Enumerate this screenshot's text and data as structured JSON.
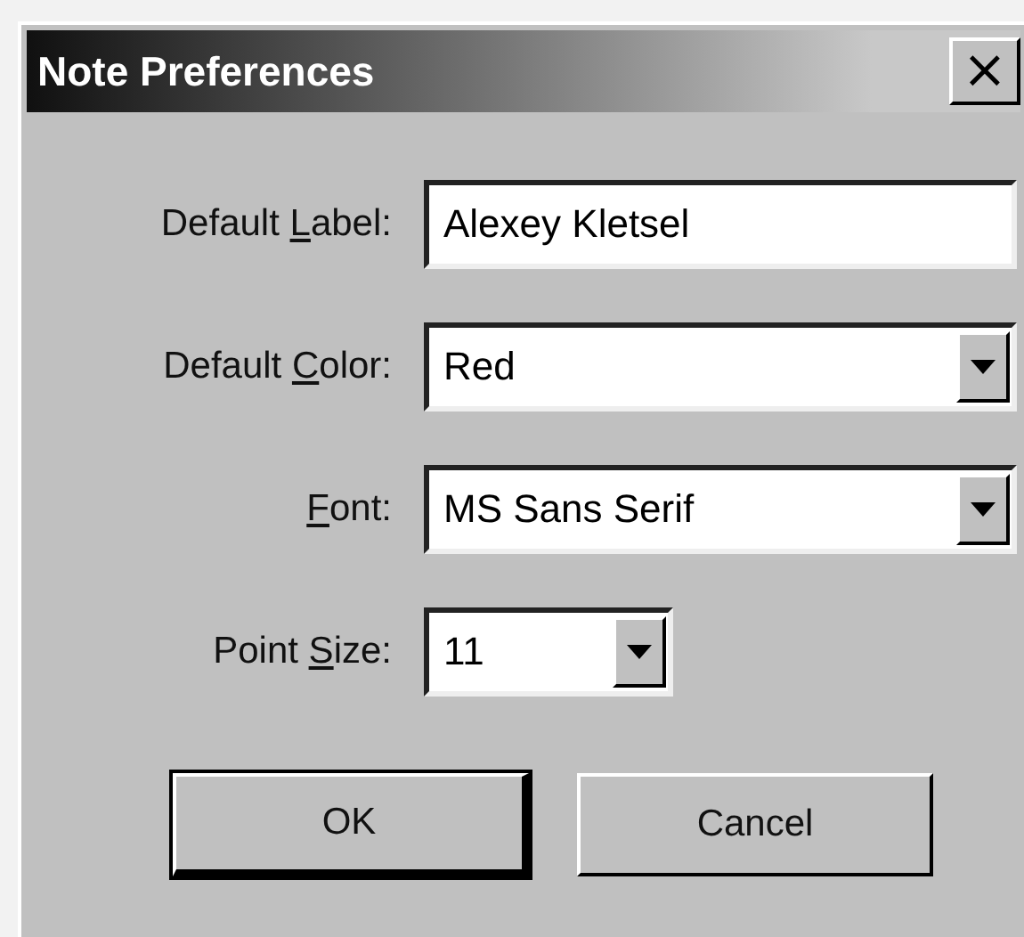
{
  "window": {
    "title": "Note Preferences",
    "close": "×"
  },
  "fields": [
    {
      "kind": "text",
      "label_parts": [
        "Default ",
        "L",
        "abel:"
      ],
      "value": "Alexey Kletsel",
      "wide": true
    },
    {
      "kind": "combo",
      "label_parts": [
        "Default ",
        "C",
        "olor:"
      ],
      "value": "Red",
      "wide": true
    },
    {
      "kind": "combo",
      "label_parts": [
        "F",
        "ont:"
      ],
      "value": "MS Sans Serif",
      "wide": true
    },
    {
      "kind": "combo",
      "label_parts": [
        "Point ",
        "S",
        "ize:"
      ],
      "value": "11",
      "wide": false
    }
  ],
  "buttons": [
    {
      "label": "OK",
      "default": true
    },
    {
      "label": "Cancel",
      "default": false
    }
  ]
}
